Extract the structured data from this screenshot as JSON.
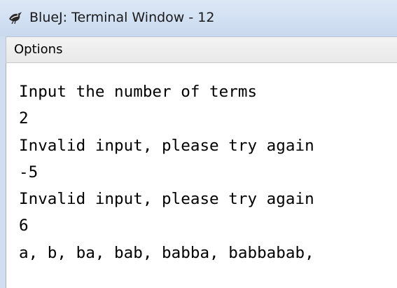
{
  "window": {
    "title": "BlueJ: Terminal Window - 12",
    "app_icon": "bluej-bird-icon"
  },
  "menubar": {
    "items": [
      {
        "label": "Options"
      }
    ]
  },
  "terminal": {
    "lines": [
      "Input the number of terms",
      "2",
      "Invalid input, please try again",
      "-5",
      "Invalid input, please try again",
      "6",
      "a, b, ba, bab, babba, babbabab,"
    ]
  }
}
